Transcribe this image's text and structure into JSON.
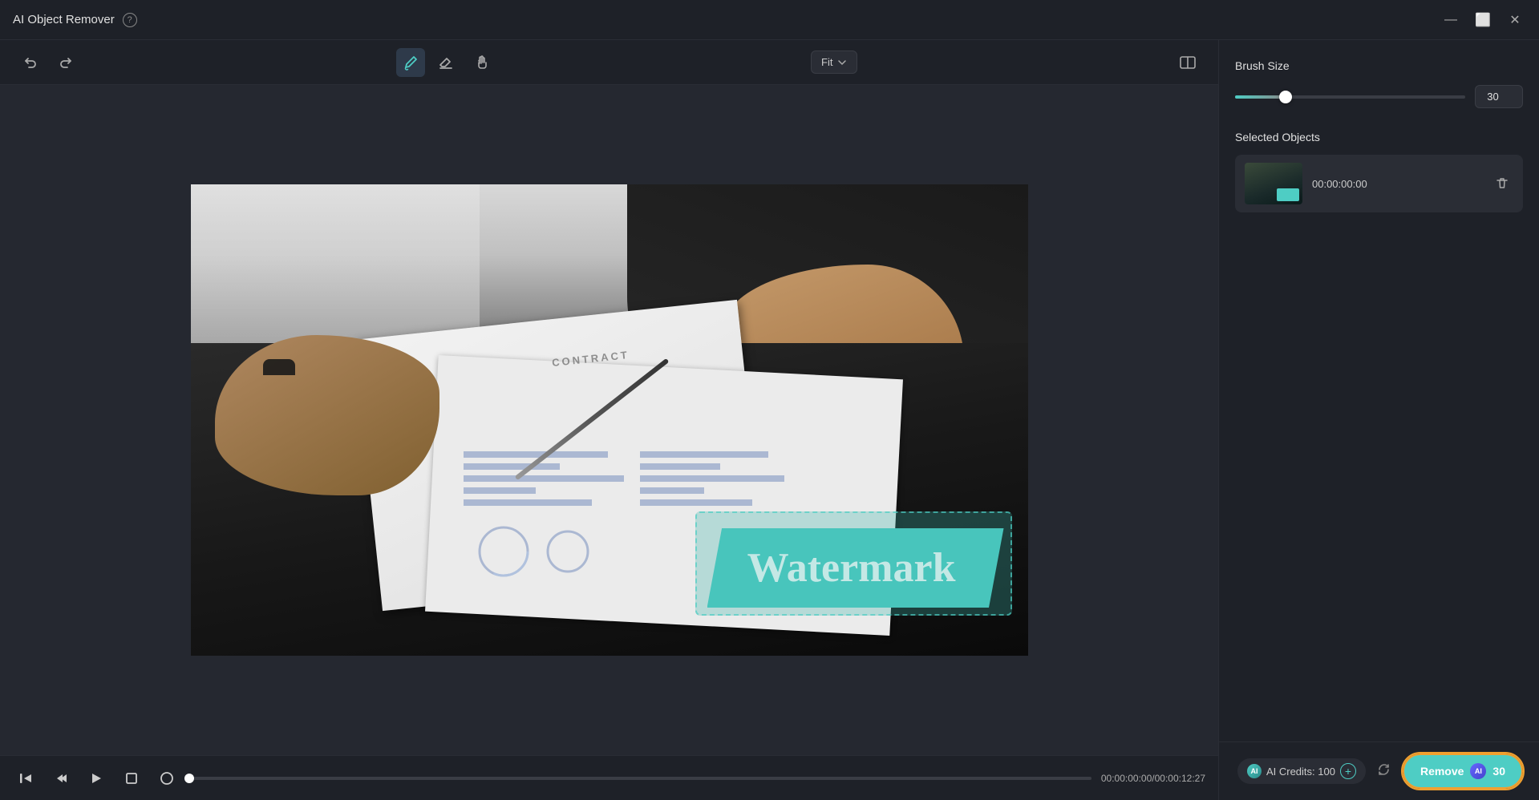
{
  "app": {
    "title": "AI Object Remover",
    "help_icon": "?",
    "window_controls": {
      "minimize": "—",
      "maximize": "⬜",
      "close": "✕"
    }
  },
  "toolbar": {
    "undo_label": "Undo",
    "redo_label": "Redo",
    "brush_label": "Brush",
    "eraser_label": "Eraser",
    "hand_label": "Hand",
    "fit_label": "Fit",
    "compare_label": "Compare"
  },
  "video": {
    "watermark_text": "Watermark",
    "contract_text": "CONTRACT"
  },
  "playback": {
    "time_display": "00:00:00:00/00:00:12:27"
  },
  "right_panel": {
    "brush_size_label": "Brush Size",
    "brush_size_value": "30",
    "selected_objects_label": "Selected Objects",
    "object_timestamp": "00:00:00:00",
    "delete_icon": "🗑"
  },
  "footer": {
    "ai_credits_label": "AI Credits: 100",
    "remove_label": "Remove",
    "remove_credits": "30"
  }
}
